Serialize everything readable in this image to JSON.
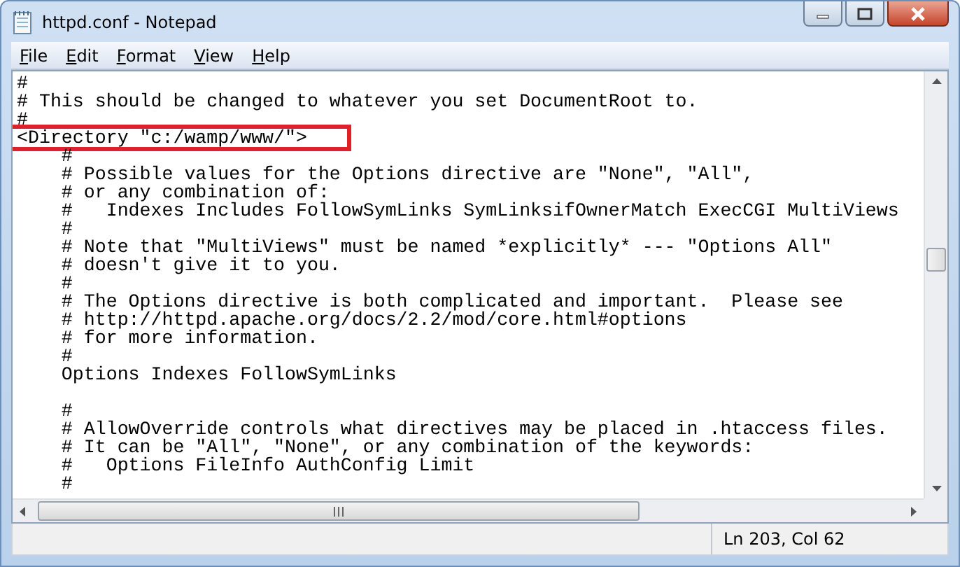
{
  "window": {
    "title": "httpd.conf - Notepad"
  },
  "menu": [
    {
      "label": "File"
    },
    {
      "label": "Edit"
    },
    {
      "label": "Format"
    },
    {
      "label": "View"
    },
    {
      "label": "Help"
    }
  ],
  "editor": {
    "lines": [
      {
        "text": "#",
        "highlighted": false
      },
      {
        "text": "# This should be changed to whatever you set DocumentRoot to.",
        "highlighted": false
      },
      {
        "text": "#",
        "highlighted": false
      },
      {
        "text": "<Directory \"c:/wamp/www/\">",
        "highlighted": true
      },
      {
        "text": "    #",
        "highlighted": false
      },
      {
        "text": "    # Possible values for the Options directive are \"None\", \"All\",",
        "highlighted": false
      },
      {
        "text": "    # or any combination of:",
        "highlighted": false
      },
      {
        "text": "    #   Indexes Includes FollowSymLinks SymLinksifOwnerMatch ExecCGI MultiViews",
        "highlighted": false
      },
      {
        "text": "    #",
        "highlighted": false
      },
      {
        "text": "    # Note that \"MultiViews\" must be named *explicitly* --- \"Options All\"",
        "highlighted": false
      },
      {
        "text": "    # doesn't give it to you.",
        "highlighted": false
      },
      {
        "text": "    #",
        "highlighted": false
      },
      {
        "text": "    # The Options directive is both complicated and important.  Please see",
        "highlighted": false
      },
      {
        "text": "    # http://httpd.apache.org/docs/2.2/mod/core.html#options",
        "highlighted": false
      },
      {
        "text": "    # for more information.",
        "highlighted": false
      },
      {
        "text": "    #",
        "highlighted": false
      },
      {
        "text": "    Options Indexes FollowSymLinks",
        "highlighted": false
      },
      {
        "highlighted": false
      },
      {
        "text": "    #",
        "highlighted": false
      },
      {
        "text": "    # AllowOverride controls what directives may be placed in .htaccess files.",
        "highlighted": false
      },
      {
        "text": "    # It can be \"All\", \"None\", or any combination of the keywords:",
        "highlighted": false
      },
      {
        "text": "    #   Options FileInfo AuthConfig Limit",
        "highlighted": false
      },
      {
        "text": "    #",
        "highlighted": false
      }
    ]
  },
  "status_bar": {
    "position": "Ln 203, Col 62"
  }
}
